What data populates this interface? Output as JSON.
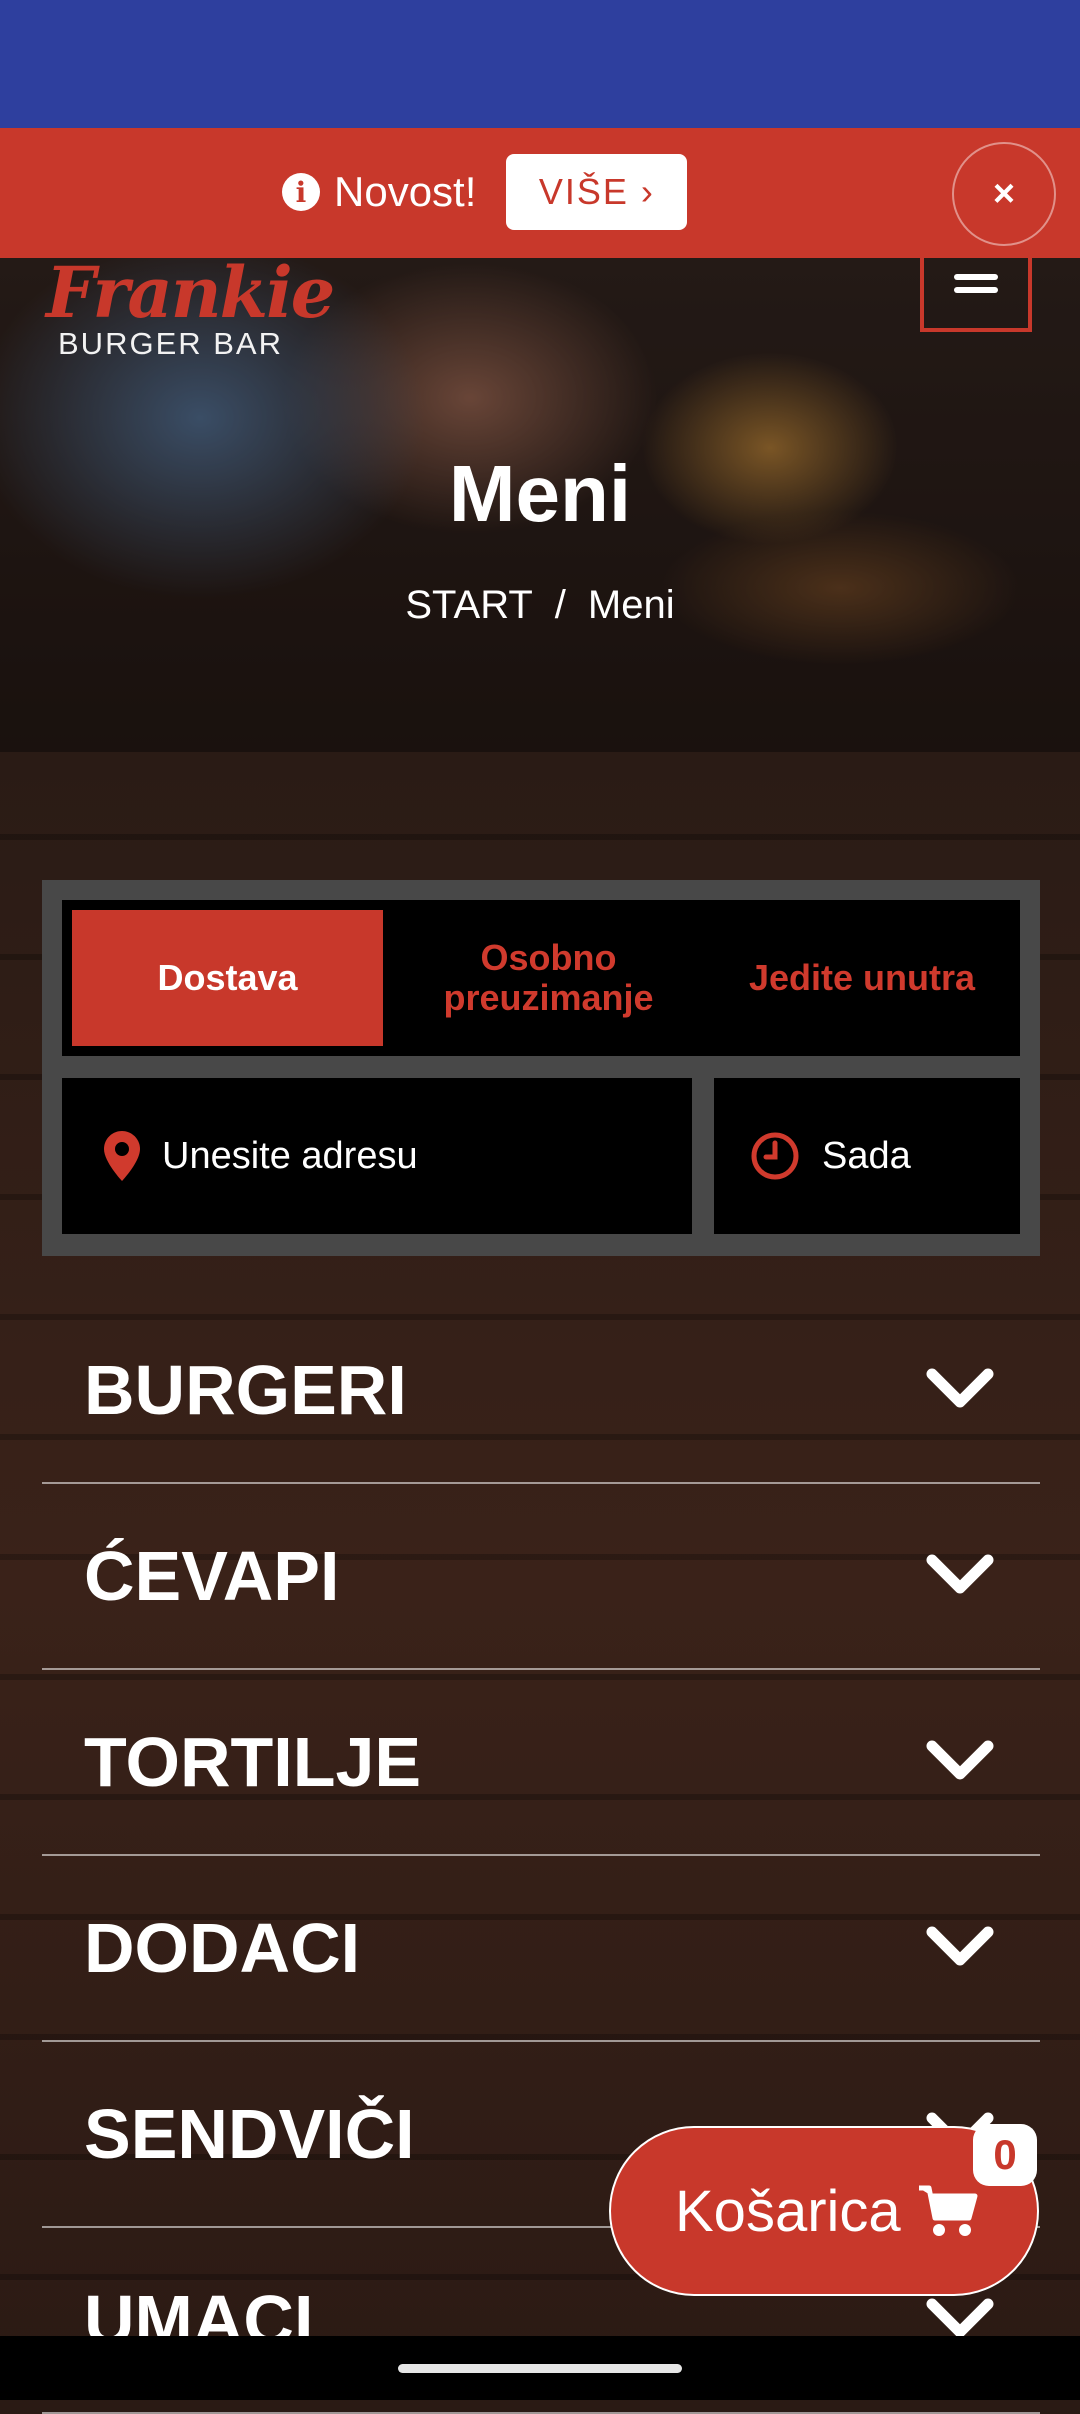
{
  "promo": {
    "text": "Novost!",
    "more_label": "VIŠE ›",
    "close_symbol": "×",
    "accent": "#c8382b"
  },
  "brand": {
    "logo_text": "Frankie",
    "logo_subtitle": "BURGER BAR"
  },
  "hero": {
    "title": "Meni",
    "breadcrumb": {
      "home": "START",
      "separator": "/",
      "current": "Meni"
    }
  },
  "order": {
    "tabs": [
      {
        "label": "Dostava",
        "active": true
      },
      {
        "label": "Osobno preuzimanje",
        "active": false
      },
      {
        "label": "Jedite unutra",
        "active": false
      }
    ],
    "address_placeholder": "Unesite adresu",
    "time_value": "Sada"
  },
  "categories": [
    "BURGERI",
    "ĆEVAPI",
    "TORTILJE",
    "DODACI",
    "SENDVIČI",
    "UMACI"
  ],
  "cart": {
    "label": "Košarica",
    "count": "0"
  },
  "icons": {
    "info": "info-icon",
    "location": "location-pin-icon",
    "clock": "clock-icon",
    "chevron": "chevron-down-icon",
    "cart": "shopping-cart-icon",
    "menu": "hamburger-menu-icon"
  }
}
